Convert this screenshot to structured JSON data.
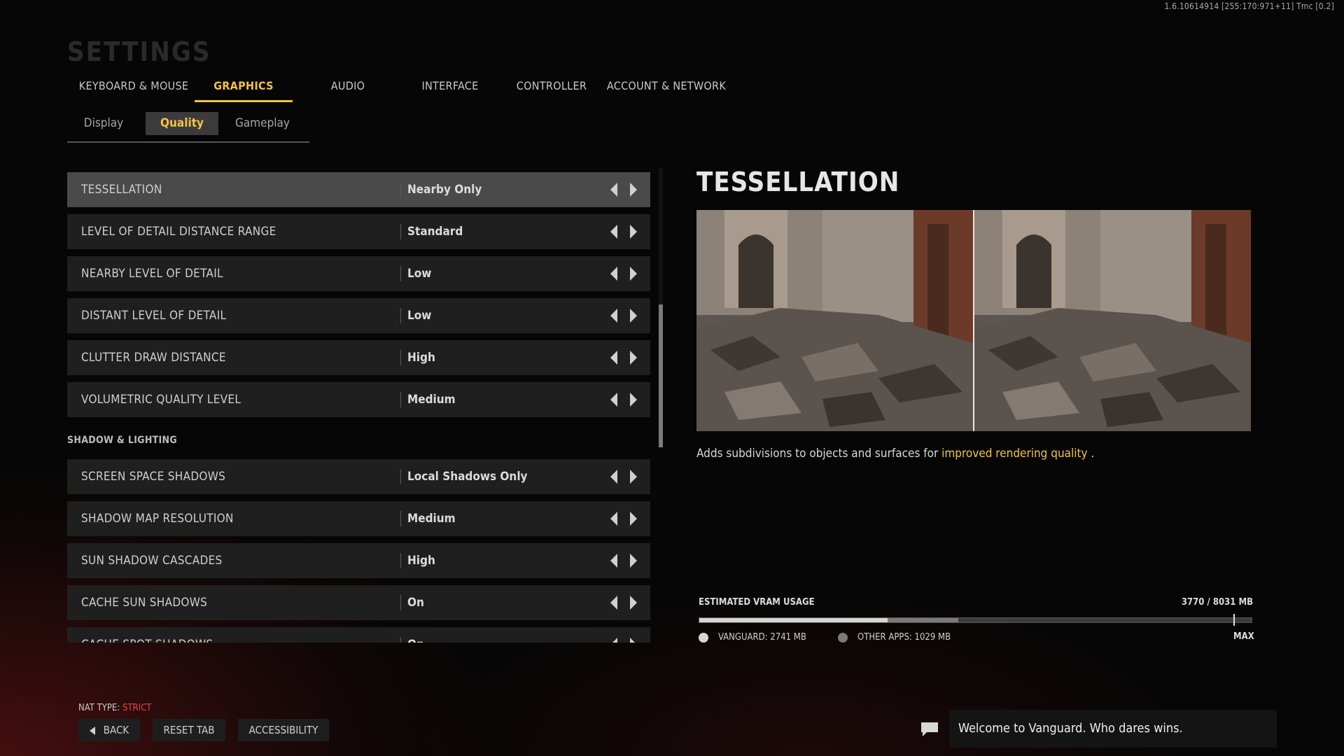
{
  "build_info": "1.6.10614914 [255:170:971+11] Tmc [0.2]",
  "page_title": "SETTINGS",
  "tabs": [
    {
      "label": "KEYBOARD & MOUSE",
      "active": false
    },
    {
      "label": "GRAPHICS",
      "active": true
    },
    {
      "label": "AUDIO",
      "active": false
    },
    {
      "label": "INTERFACE",
      "active": false
    },
    {
      "label": "CONTROLLER",
      "active": false
    },
    {
      "label": "ACCOUNT & NETWORK",
      "active": false
    }
  ],
  "subtabs": [
    {
      "label": "Display",
      "active": false
    },
    {
      "label": "Quality",
      "active": true
    },
    {
      "label": "Gameplay",
      "active": false
    }
  ],
  "settings": [
    {
      "label": "TESSELLATION",
      "value": "Nearby Only",
      "selected": true
    },
    {
      "label": "LEVEL OF DETAIL DISTANCE RANGE",
      "value": "Standard"
    },
    {
      "label": "NEARBY LEVEL OF DETAIL",
      "value": "Low"
    },
    {
      "label": "DISTANT LEVEL OF DETAIL",
      "value": "Low"
    },
    {
      "label": "CLUTTER DRAW DISTANCE",
      "value": "High"
    },
    {
      "label": "VOLUMETRIC QUALITY LEVEL",
      "value": "Medium"
    }
  ],
  "section_shadow": "SHADOW & LIGHTING",
  "shadow_settings": [
    {
      "label": "SCREEN SPACE SHADOWS",
      "value": "Local Shadows Only"
    },
    {
      "label": "SHADOW MAP RESOLUTION",
      "value": "Medium"
    },
    {
      "label": "SUN SHADOW CASCADES",
      "value": "High"
    },
    {
      "label": "CACHE SUN SHADOWS",
      "value": "On"
    },
    {
      "label": "CACHE SPOT SHADOWS",
      "value": "On"
    }
  ],
  "detail": {
    "title": "TESSELLATION",
    "description_prefix": "Adds subdivisions to objects and surfaces for ",
    "description_highlight": "improved rendering quality",
    "description_suffix": " ."
  },
  "vram": {
    "label": "ESTIMATED VRAM USAGE",
    "total_text": "3770 / 8031 MB",
    "vanguard_mb": 2741,
    "other_mb": 1029,
    "max_mb": 8031,
    "max_marker_fraction": 0.999,
    "vanguard_label": "VANGUARD: 2741 MB",
    "other_label": "OTHER APPS: 1029 MB",
    "max_label": "MAX",
    "vanguard_color": "#d6d6d6",
    "other_color": "#7a7a7a"
  },
  "nat": {
    "prefix": "NAT TYPE: ",
    "value": "STRICT",
    "value_color": "#e04545"
  },
  "buttons": {
    "back": "BACK",
    "reset": "RESET TAB",
    "accessibility": "ACCESSIBILITY"
  },
  "toast": {
    "icon": "chat-icon",
    "message": "Welcome to Vanguard. Who dares wins."
  },
  "colors": {
    "accent": "#f2c53d",
    "row_bg": "#1f1f1f",
    "row_selected_bg": "#4a4a4a"
  }
}
